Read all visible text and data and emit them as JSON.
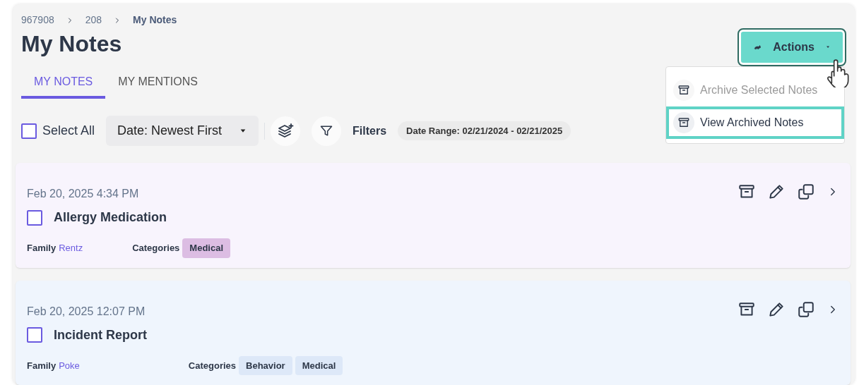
{
  "breadcrumb": [
    {
      "label": "967908",
      "current": false
    },
    {
      "label": "208",
      "current": false
    },
    {
      "label": "My Notes",
      "current": true
    }
  ],
  "title": "My Notes",
  "actions_button": {
    "label": "Actions",
    "expanded": true
  },
  "actions_menu": [
    {
      "label": "Archive Selected Notes",
      "disabled": true,
      "selected": false
    },
    {
      "label": "View Archived Notes",
      "disabled": false,
      "selected": true
    }
  ],
  "tabs": [
    {
      "label": "MY NOTES",
      "selected": true
    },
    {
      "label": "MY MENTIONS",
      "selected": false
    }
  ],
  "toolbar": {
    "select_all": {
      "label": "Select All",
      "checked": false
    },
    "sort": {
      "value": "Date: Newest First"
    },
    "filters_label": "Filters",
    "date_range": {
      "label": "Date Range:",
      "value": "02/21/2024 - 02/21/2025"
    }
  },
  "notes": [
    {
      "date": "Feb 20, 2025 4:34 PM",
      "title": "Allergy Medication",
      "checked": false,
      "color": "#f8f4fd",
      "family_label": "Family",
      "family": "Rentz",
      "categories_label": "Categories",
      "categories": [
        {
          "label": "Medical",
          "color": "#dcbde3"
        }
      ]
    },
    {
      "date": "Feb 20, 2025 12:07 PM",
      "title": "Incident Report",
      "checked": false,
      "color": "#eff5fd",
      "family_label": "Family",
      "family": "Poke",
      "categories_label": "Categories",
      "categories": [
        {
          "label": "Behavior",
          "color": "#dde8f8"
        },
        {
          "label": "Medical",
          "color": "#dde8f8"
        }
      ]
    }
  ]
}
